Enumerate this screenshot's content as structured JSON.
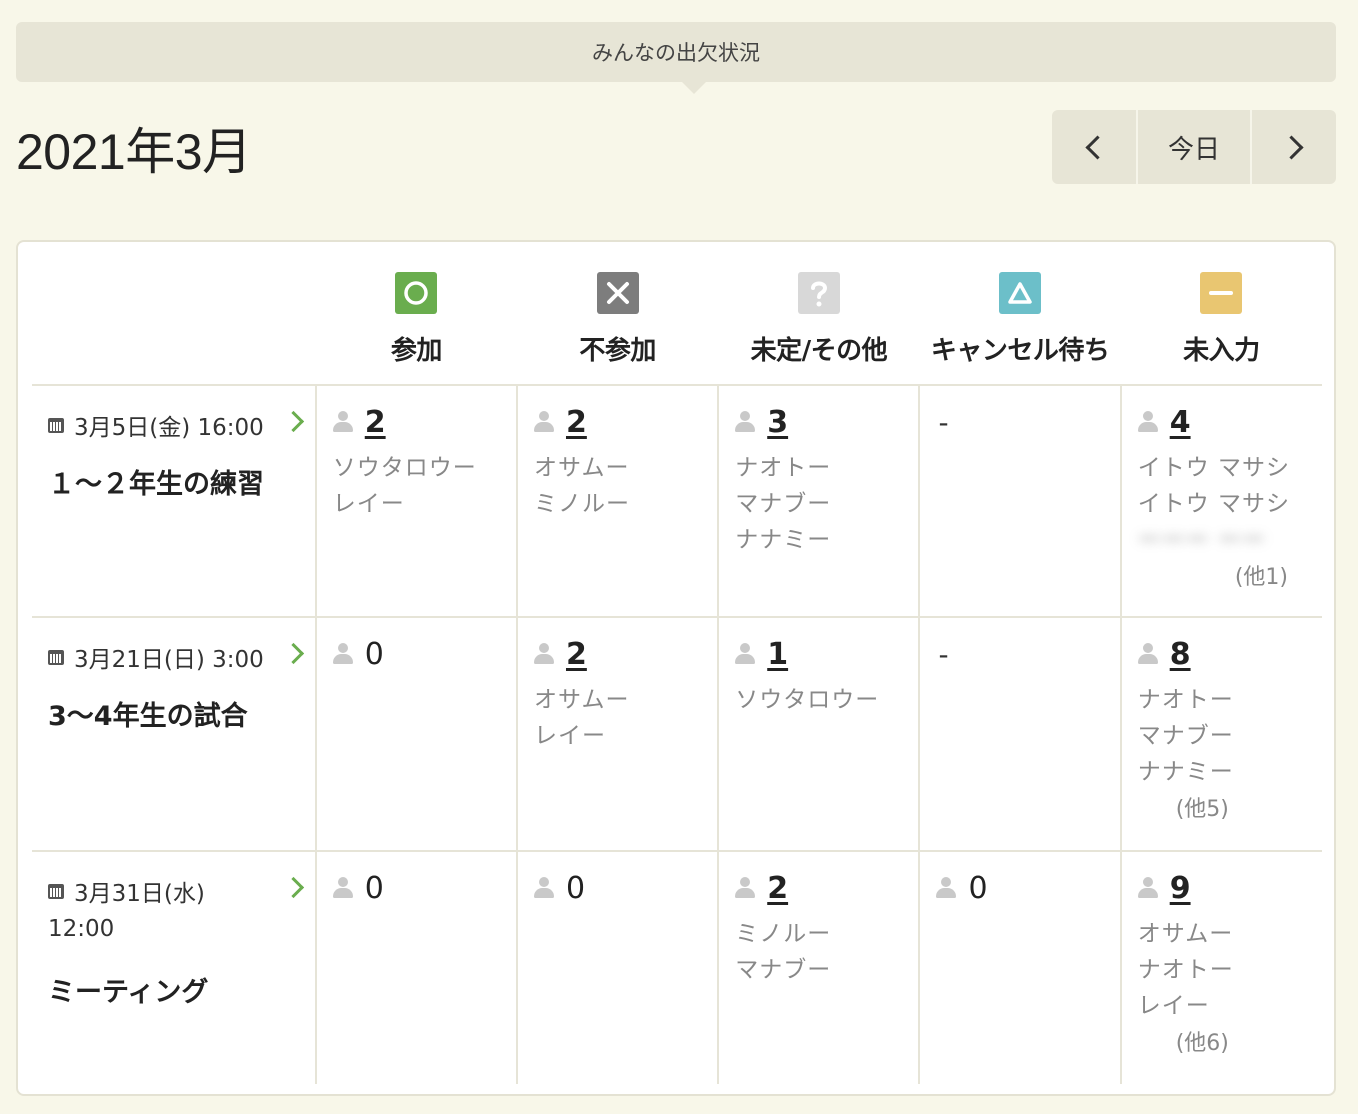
{
  "tab": {
    "label": "みんなの出欠状況"
  },
  "header": {
    "month_title": "2021年3月",
    "nav": {
      "today": "今日"
    }
  },
  "statuses": [
    {
      "key": "yes",
      "label": "参加",
      "icon": "circle-icon",
      "color": "#6aad4e"
    },
    {
      "key": "no",
      "label": "不参加",
      "icon": "cross-icon",
      "color": "#7d7d7d"
    },
    {
      "key": "undecided",
      "label": "未定/その他",
      "icon": "question-icon",
      "color": "#d8d8d8"
    },
    {
      "key": "waiting",
      "label": "キャンセル待ち",
      "icon": "triangle-icon",
      "color": "#6cbfc9"
    },
    {
      "key": "none",
      "label": "未入力",
      "icon": "minus-icon",
      "color": "#e9c671"
    }
  ],
  "events": [
    {
      "date": "3月5日(金) 16:00",
      "name": "１～２年生の練習",
      "cells": [
        {
          "count": "2",
          "names": [
            "ソウタロウー",
            "レイー"
          ]
        },
        {
          "count": "2",
          "names": [
            "オサムー",
            "ミノルー"
          ]
        },
        {
          "count": "3",
          "names": [
            "ナオトー",
            "マナブー",
            "ナナミー"
          ]
        },
        {
          "dash": "-"
        },
        {
          "count": "4",
          "names": [
            "イトウ マサシ",
            "イトウ マサシ"
          ],
          "more": "(他1)"
        }
      ]
    },
    {
      "date": "3月21日(日) 3:00",
      "name": "3～4年生の試合",
      "cells": [
        {
          "count": "0"
        },
        {
          "count": "2",
          "names": [
            "オサムー",
            "レイー"
          ]
        },
        {
          "count": "1",
          "names": [
            "ソウタロウー"
          ]
        },
        {
          "dash": "-"
        },
        {
          "count": "8",
          "names": [
            "ナオトー",
            "マナブー",
            "ナナミー"
          ],
          "more": "(他5)"
        }
      ]
    },
    {
      "date": "3月31日(水)",
      "time": "12:00",
      "name": "ミーティング",
      "cells": [
        {
          "count": "0"
        },
        {
          "count": "0"
        },
        {
          "count": "2",
          "names": [
            "ミノルー",
            "マナブー"
          ]
        },
        {
          "count": "0"
        },
        {
          "count": "9",
          "names": [
            "オサムー",
            "ナオトー",
            "レイー"
          ],
          "more": "(他6)"
        }
      ]
    }
  ]
}
